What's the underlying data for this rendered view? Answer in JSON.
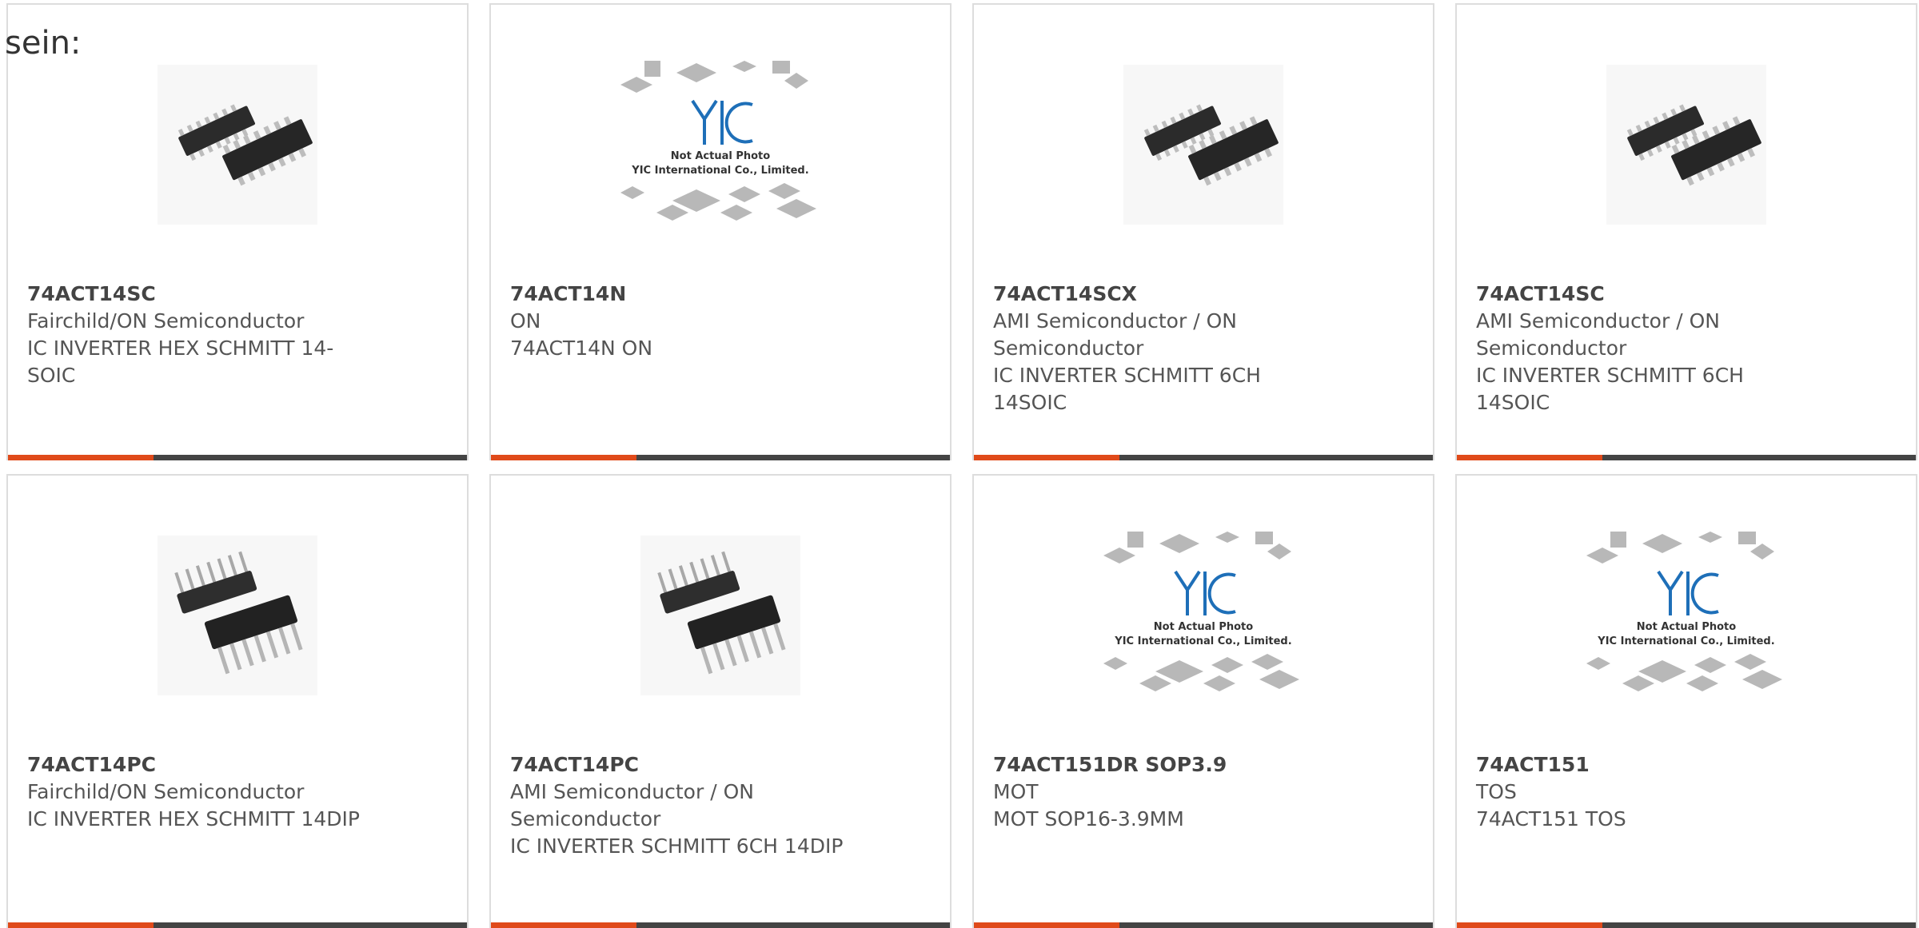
{
  "lead_text": "sein:",
  "colors": {
    "accent": "#e04a1a",
    "bar": "#444444",
    "border": "#dddddd",
    "text": "#555555",
    "yic_blue": "#1e6fb8"
  },
  "products": [
    {
      "part": "74ACT14SC",
      "maker": "Fairchild/ON Semiconductor",
      "desc": "IC INVERTER HEX SCHMITT 14-SOIC",
      "image": "soic-chip-photo"
    },
    {
      "part": "74ACT14N",
      "maker": "ON",
      "desc": "74ACT14N ON",
      "image": "placeholder-photo"
    },
    {
      "part": "74ACT14SCX",
      "maker": "AMI Semiconductor / ON Semiconductor",
      "desc": "IC INVERTER SCHMITT 6CH 14SOIC",
      "image": "soic-chip-photo"
    },
    {
      "part": "74ACT14SC",
      "maker": "AMI Semiconductor / ON Semiconductor",
      "desc": "IC INVERTER SCHMITT 6CH 14SOIC",
      "image": "soic-chip-photo"
    },
    {
      "part": "74ACT14PC",
      "maker": "Fairchild/ON Semiconductor",
      "desc": "IC INVERTER HEX SCHMITT 14DIP",
      "image": "dip-chip-photo"
    },
    {
      "part": "74ACT14PC",
      "maker": "AMI Semiconductor / ON Semiconductor",
      "desc": "IC INVERTER SCHMITT 6CH 14DIP",
      "image": "dip-chip-photo"
    },
    {
      "part": "74ACT151DR SOP3.9",
      "maker": "MOT",
      "desc": "MOT SOP16-3.9MM",
      "image": "placeholder-photo"
    },
    {
      "part": "74ACT151",
      "maker": "TOS",
      "desc": "74ACT151 TOS",
      "image": "placeholder-photo"
    }
  ],
  "placeholder": {
    "logo": "YIC",
    "line1": "Not Actual Photo",
    "line2": "YIC International Co., Limited."
  }
}
